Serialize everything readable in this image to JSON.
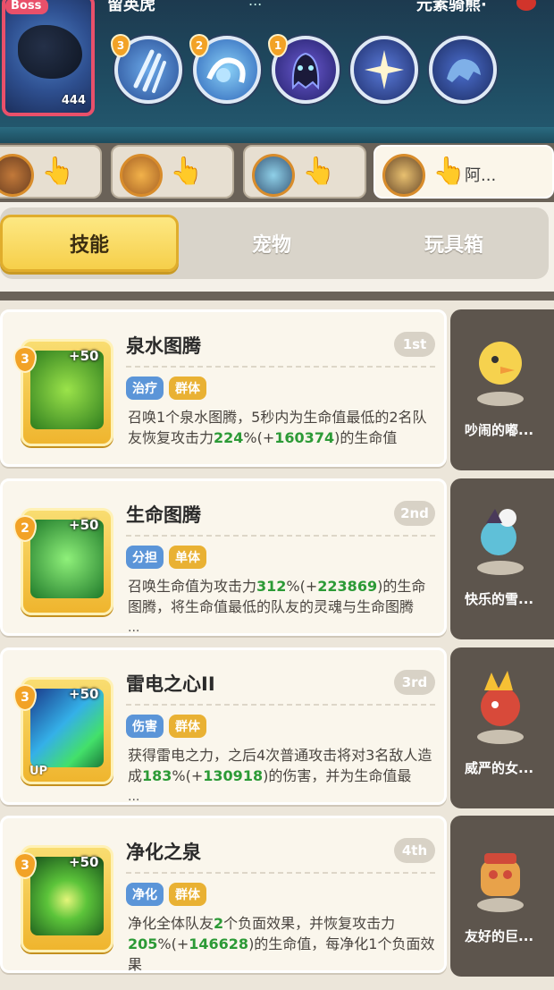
{
  "top": {
    "boss_tag": "Boss",
    "boss_level": "444",
    "boss_name": "留英虎",
    "mid_text": "...",
    "right_text": "元素骑熊·",
    "skills": [
      {
        "level": "3",
        "icon": "claw-slash-icon"
      },
      {
        "level": "2",
        "icon": "water-wave-icon"
      },
      {
        "level": "1",
        "icon": "ghost-icon"
      },
      {
        "level": "",
        "icon": "bat-spark-icon"
      },
      {
        "level": "",
        "icon": "shadow-beast-icon"
      }
    ]
  },
  "team": {
    "slots": [
      {
        "label": ""
      },
      {
        "label": ""
      },
      {
        "label": ""
      },
      {
        "label": "阿..."
      }
    ]
  },
  "tabs": [
    {
      "label": "技能",
      "active": true
    },
    {
      "label": "宠物",
      "active": false
    },
    {
      "label": "玩具箱",
      "active": false
    }
  ],
  "skills": [
    {
      "level": "3",
      "bonus": "+50",
      "name": "泉水图腾",
      "rank": "1st",
      "tags": [
        "治疗",
        "群体"
      ],
      "desc_parts": [
        "召唤1个泉水图腾，5秒内为生命值最低的2名队友恢复攻击力",
        "224",
        "%(+",
        "160374",
        ")的生命值"
      ],
      "more": "",
      "pet_name": "吵闹的嘟..."
    },
    {
      "level": "2",
      "bonus": "+50",
      "name": "生命图腾",
      "rank": "2nd",
      "tags": [
        "分担",
        "单体"
      ],
      "desc_parts": [
        "召唤生命值为攻击力",
        "312",
        "%(+",
        "223869",
        ")的生命图腾，将生命值最低的队友的灵魂与生命图腾"
      ],
      "more": "...",
      "pet_name": "快乐的雪..."
    },
    {
      "level": "3",
      "bonus": "+50",
      "name": "雷电之心II",
      "rank": "3rd",
      "tags": [
        "伤害",
        "群体"
      ],
      "desc_parts": [
        "获得雷电之力，之后4次普通攻击将对3名敌人造成",
        "183",
        "%(+",
        "130918",
        ")的伤害，并为生命值最"
      ],
      "more": "...",
      "up": "UP",
      "pet_name": "威严的女..."
    },
    {
      "level": "3",
      "bonus": "+50",
      "name": "净化之泉",
      "rank": "4th",
      "tags": [
        "净化",
        "群体"
      ],
      "desc_parts": [
        "净化全体队友",
        "2",
        "个负面效果，并恢复攻击力",
        "205",
        "%(+",
        "146628",
        ")的生命值，每净化1个负面效果"
      ],
      "more": "...",
      "pet_name": "友好的巨..."
    }
  ]
}
